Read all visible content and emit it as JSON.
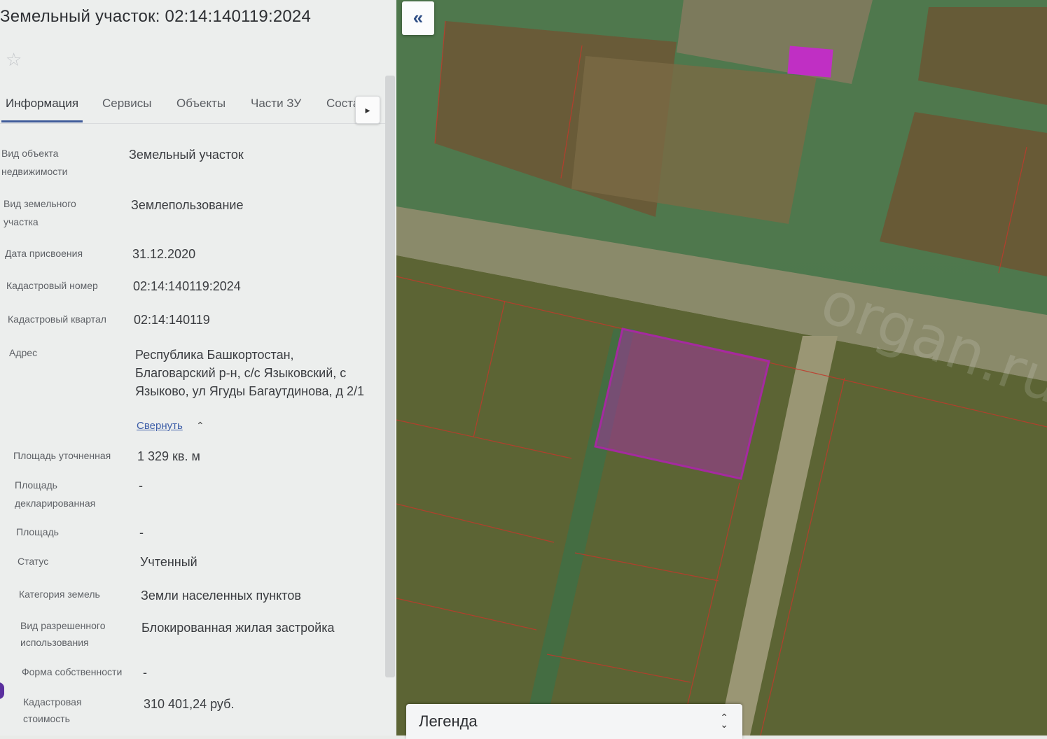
{
  "header": {
    "title": "Земельный участок: 02:14:140119:2024"
  },
  "tabs": [
    {
      "label": "Информация"
    },
    {
      "label": "Сервисы"
    },
    {
      "label": "Объекты"
    },
    {
      "label": "Части ЗУ"
    },
    {
      "label": "Соста"
    }
  ],
  "info": {
    "object_type": {
      "label": "Вид объекта недвижимости",
      "value": "Земельный участок"
    },
    "land_type": {
      "label": "Вид земельного участка",
      "value": "Землепользование"
    },
    "assign_date": {
      "label": "Дата присвоения",
      "value": "31.12.2020"
    },
    "cad_number": {
      "label": "Кадастровый номер",
      "value": "02:14:140119:2024"
    },
    "cad_quarter": {
      "label": "Кадастровый квартал",
      "value": "02:14:140119"
    },
    "address": {
      "label": "Адрес",
      "value": "Республика Башкортостан, Благоварский р-н, с/с Языковский, с Языково, ул Ягуды Багаутдинова, д 2/1",
      "collapse": "Свернуть"
    },
    "area_refined": {
      "label": "Площадь уточненная",
      "value": "1 329 кв. м"
    },
    "area_declared": {
      "label": "Площадь декларированная",
      "value": "-"
    },
    "area": {
      "label": "Площадь",
      "value": "-"
    },
    "status": {
      "label": "Статус",
      "value": "Учтенный"
    },
    "land_category": {
      "label": "Категория земель",
      "value": "Земли населенных пунктов"
    },
    "permitted_use": {
      "label": "Вид разрешенного использования",
      "value": "Блокированная жилая застройка"
    },
    "ownership": {
      "label": "Форма собственности",
      "value": "-"
    },
    "cad_value": {
      "label": "Кадастровая стоимость",
      "value": "310 401,24 руб."
    }
  },
  "map": {
    "watermark": "organ.ru",
    "legend": {
      "label": "Легенда"
    },
    "parcel_highlight_color": "#a0349c",
    "boundary_color": "#c0392b"
  }
}
